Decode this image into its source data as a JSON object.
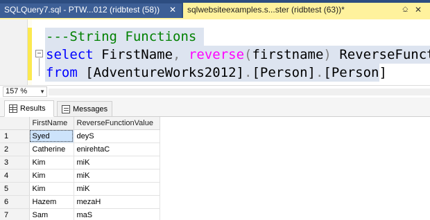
{
  "tabs": [
    {
      "label": "SQLQuery7.sql - PTW...012 (ridbtest (58))",
      "active": false
    },
    {
      "label": "sqlwebsiteexamples.s...ster (ridbtest (63))*",
      "active": true
    }
  ],
  "tab_close_glyph": "✕",
  "tab_pin_glyph": "⎐",
  "editor": {
    "line1": {
      "comment": "---String Functions"
    },
    "line2": {
      "kw": "select",
      "t1": " FirstName",
      "p1": ",",
      "t2": " ",
      "fn": "reverse",
      "p2": "(",
      "t3": "firstname",
      "p3": ")",
      "t4": " ReverseFunct:"
    },
    "line3": {
      "kw": "from",
      "t1": " ",
      "b1": "[AdventureWorks2012]",
      "d1": ".",
      "b2": "[Person]",
      "d2": ".",
      "b3": "[Person]"
    }
  },
  "zoom": {
    "value": "157 %"
  },
  "results_tabs": {
    "results": "Results",
    "messages": "Messages"
  },
  "grid": {
    "columns": [
      "FirstName",
      "ReverseFunctionValue"
    ],
    "rows": [
      {
        "n": "1",
        "first": "Syed",
        "rev": "deyS"
      },
      {
        "n": "2",
        "first": "Catherine",
        "rev": "enirehtaC"
      },
      {
        "n": "3",
        "first": "Kim",
        "rev": "miK"
      },
      {
        "n": "4",
        "first": "Kim",
        "rev": "miK"
      },
      {
        "n": "5",
        "first": "Kim",
        "rev": "miK"
      },
      {
        "n": "6",
        "first": "Hazem",
        "rev": "mezaH"
      },
      {
        "n": "7",
        "first": "Sam",
        "rev": "maS"
      }
    ]
  },
  "colors": {
    "tabstrip": "#2d4d80",
    "active_tab": "#fff29d",
    "comment": "#008000",
    "keyword": "#0000ff",
    "function": "#ff00ff",
    "operator": "#808080",
    "selection": "#dde4f0"
  },
  "icons": [
    "close-icon",
    "pin-icon",
    "collapse-icon",
    "grid-icon",
    "messages-icon"
  ]
}
